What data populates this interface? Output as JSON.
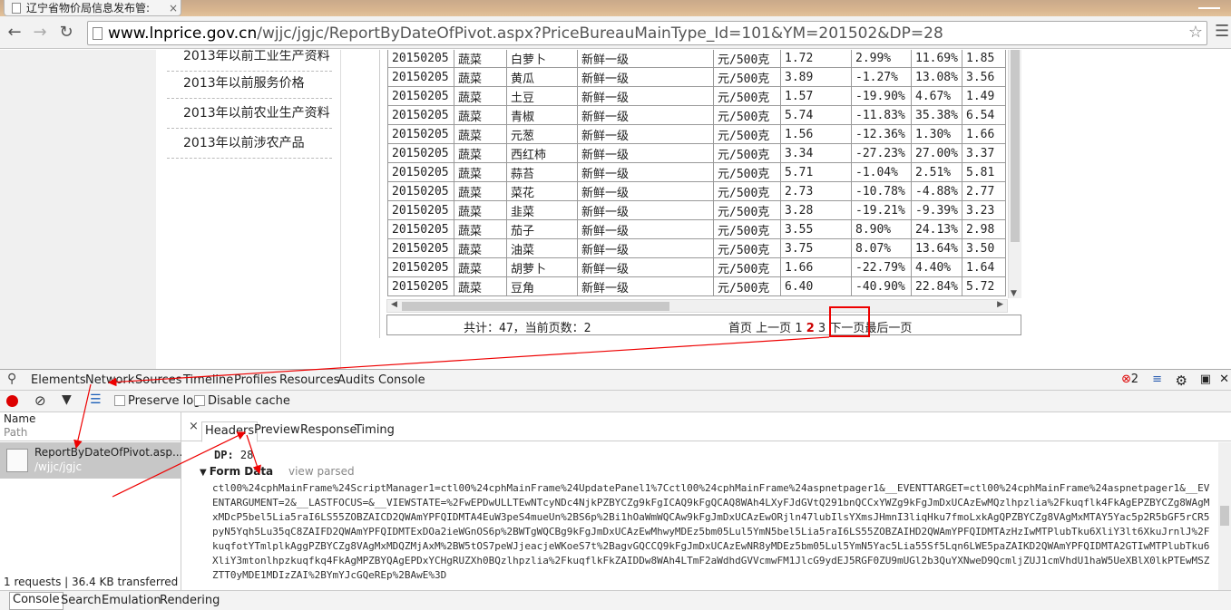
{
  "browser": {
    "tab_title": "辽宁省物价局信息发布管:",
    "tab_close": "×",
    "url_host": "www.lnprice.gov.cn",
    "url_path": "/wjjc/jgjc/ReportByDateOfPivot.aspx?PriceBureauMainType_Id=101&YM=201502&DP=28"
  },
  "left_menu": [
    "2013年以前工业生产资料",
    "2013年以前服务价格",
    "2013年以前农业生产资料",
    "2013年以前涉农产品"
  ],
  "table_rows": [
    [
      "20150205",
      "蔬菜",
      "白萝卜",
      "新鲜一级",
      "元/500克",
      "1.72",
      "2.99%",
      "11.69%",
      "1.85"
    ],
    [
      "20150205",
      "蔬菜",
      "黄瓜",
      "新鲜一级",
      "元/500克",
      "3.89",
      "-1.27%",
      "13.08%",
      "3.56"
    ],
    [
      "20150205",
      "蔬菜",
      "土豆",
      "新鲜一级",
      "元/500克",
      "1.57",
      "-19.90%",
      "4.67%",
      "1.49"
    ],
    [
      "20150205",
      "蔬菜",
      "青椒",
      "新鲜一级",
      "元/500克",
      "5.74",
      "-11.83%",
      "35.38%",
      "6.54"
    ],
    [
      "20150205",
      "蔬菜",
      "元葱",
      "新鲜一级",
      "元/500克",
      "1.56",
      "-12.36%",
      "1.30%",
      "1.66"
    ],
    [
      "20150205",
      "蔬菜",
      "西红柿",
      "新鲜一级",
      "元/500克",
      "3.34",
      "-27.23%",
      "27.00%",
      "3.37"
    ],
    [
      "20150205",
      "蔬菜",
      "蒜苔",
      "新鲜一级",
      "元/500克",
      "5.71",
      "-1.04%",
      "2.51%",
      "5.81"
    ],
    [
      "20150205",
      "蔬菜",
      "菜花",
      "新鲜一级",
      "元/500克",
      "2.73",
      "-10.78%",
      "-4.88%",
      "2.77"
    ],
    [
      "20150205",
      "蔬菜",
      "韭菜",
      "新鲜一级",
      "元/500克",
      "3.28",
      "-19.21%",
      "-9.39%",
      "3.23"
    ],
    [
      "20150205",
      "蔬菜",
      "茄子",
      "新鲜一级",
      "元/500克",
      "3.55",
      "8.90%",
      "24.13%",
      "2.98"
    ],
    [
      "20150205",
      "蔬菜",
      "油菜",
      "新鲜一级",
      "元/500克",
      "3.75",
      "8.07%",
      "13.64%",
      "3.50"
    ],
    [
      "20150205",
      "蔬菜",
      "胡萝卜",
      "新鲜一级",
      "元/500克",
      "1.66",
      "-22.79%",
      "4.40%",
      "1.64"
    ],
    [
      "20150205",
      "蔬菜",
      "豆角",
      "新鲜一级",
      "元/500克",
      "6.40",
      "-40.90%",
      "22.84%",
      "5.72"
    ]
  ],
  "pager": {
    "summary": "共计：47，当前页数：2",
    "first": "首页",
    "prev": "上一页",
    "page1": "1",
    "page2": "2",
    "page3": "3",
    "next": "下一页",
    "last": "最后一页"
  },
  "devtools": {
    "tabs": [
      "Elements",
      "Network",
      "Sources",
      "Timeline",
      "Profiles",
      "Resources",
      "Audits",
      "Console"
    ],
    "error_count": "2",
    "preserve_log": "Preserve log",
    "disable_cache": "Disable cache",
    "col_name": "Name",
    "col_path": "Path",
    "request_name": "ReportByDateOfPivot.asp...",
    "request_path": "/wjjc/jgjc",
    "status": "1 requests | 36.4 KB transferred",
    "detail_tabs": [
      "Headers",
      "Preview",
      "Response",
      "Timing"
    ],
    "close": "×",
    "dp_key": "DP:",
    "dp_value": "28",
    "form_data": "Form Data",
    "view_parsed": "view parsed",
    "form_raw": "ctl00%24cphMainFrame%24ScriptManager1=ctl00%24cphMainFrame%24UpdatePanel1%7Cctl00%24cphMainFrame%24aspnetpager1&__EVENTTARGET=ctl00%24cphMainFrame%24aspnetpager1&__EVENTARGUMENT=2&__LASTFOCUS=&__VIEWSTATE=%2FwEPDwULLTEwNTcyNDc4NjkPZBYCZg9kFgICAQ9kFgQCAQ8WAh4LXyFJdGVtQ291bnQCCxYWZg9kFgJmDxUCAzEwMQzlhpzlia%2Fkuqflk4FkAgEPZBYCZg8WAgMxMDcP5bel5Lia5raI6LS55ZOBZAICD2QWAmYPFQIDMTA4EuW3peS4mueUn%2BS6p%2Bi1hOaWmWQCAw9kFgJmDxUCAzEwORjln47lubIlsYXmsJHmnI3liqHku7fmoLxkAgQPZBYCZg8VAgMxMTAY5Yac5p2R5bGF5rCR5pyN5Yqh5Lu35qC8ZAIFD2QWAmYPFQIDMTExDOa2ieWGnOS6p%2BWTgWQCBg9kFgJmDxUCAzEwMhwyMDEz5bm05Lul5YmN5bel5Lia5raI6LS55ZOBZAIHD2QWAmYPFQIDMTAzHzIwMTPlubTku6XliY3lt6XkuJrnlJ%2FkuqfotYTmlplkAggPZBYCZg8VAgMxMDQZMjAxM%2BW5tOS7peWJjeacjeWKoeS7t%2BagvGQCCQ9kFgJmDxUCAzEwNR8yMDEz5bm05Lul5YmN5Yac5Lia55Sf5Lqn6LWE5paZAIKD2QWAmYPFQIDMTA2GTIwMTPlubTku6XliY3mtonlhpzkuqfkq4FkAgMPZBYQAgEPDxYCHgRUZXh0BQzlhpzlia%2FkuqflkFkZAIDDw8WAh4LTmF2aWdhdGVVcmwFM1JlcG9ydEJ5RGF0ZU9mUGl2b3QuYXNweD9QcmljZUJ1cmVhdU1haW5UeXBlX0lkPTEwMSZZTT0yMDE1MDIzZAI%2BYmYJcGQeREp%2BAwE%3D"
  },
  "drawer": [
    "Console",
    "Search",
    "Emulation",
    "Rendering"
  ]
}
